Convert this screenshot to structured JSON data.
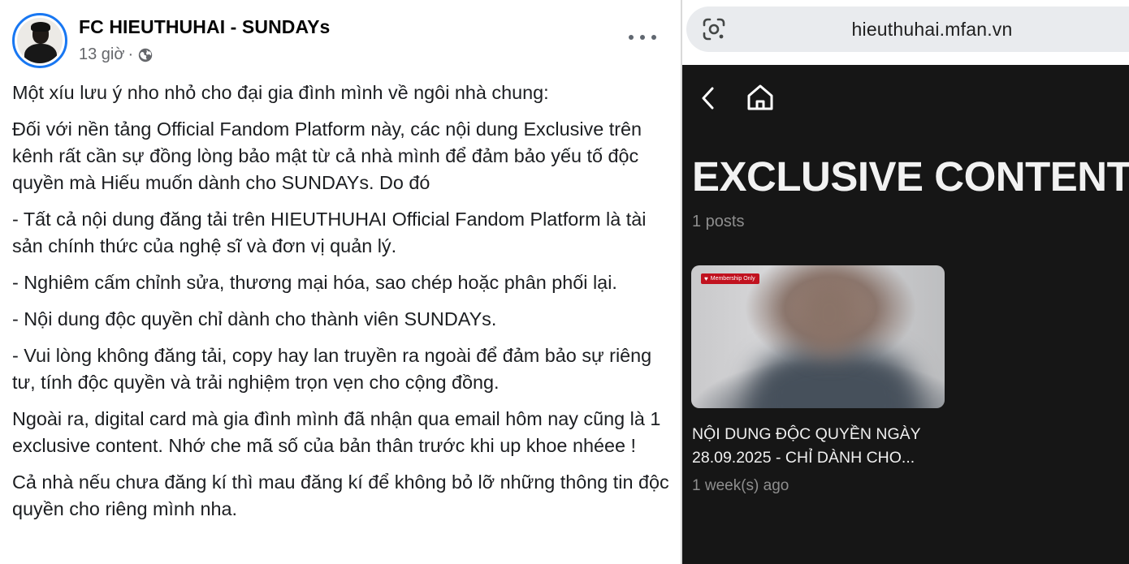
{
  "facebook_post": {
    "page_name": "FC HIEUTHUHAI - SUNDAYs",
    "time": "13 giờ",
    "separator": "·",
    "privacy_icon": "globe-icon",
    "more_icon": "more-options-icon",
    "paragraphs": [
      "Một xíu lưu ý nho nhỏ cho đại gia đình mình về ngôi nhà chung:",
      "Đối với nền tảng Official Fandom Platform này, các nội dung Exclusive trên kênh rất cần sự đồng lòng bảo mật từ cả nhà mình để đảm bảo yếu tố độc quyền mà Hiếu muốn dành cho SUNDAYs. Do đó",
      "- Tất cả nội dung đăng tải trên HIEUTHUHAI Official Fandom Platform là tài sản chính thức của nghệ sĩ và đơn vị quản lý.",
      "- Nghiêm cấm chỉnh sửa, thương mại hóa, sao chép hoặc phân phối lại.",
      "- Nội dung độc quyền chỉ dành cho thành viên SUNDAYs.",
      "- Vui lòng không đăng tải, copy hay lan truyền ra ngoài để đảm bảo sự riêng tư, tính độc quyền và trải nghiệm trọn vẹn cho cộng đồng.",
      "Ngoài ra, digital card mà gia đình mình đã nhận qua email hôm nay cũng là 1 exclusive content. Nhớ che mã số của bản thân trước khi up khoe nhéee !",
      "Cả nhà nếu chưa đăng kí thì mau đăng kí để không bỏ lỡ những thông tin độc quyền cho riêng mình nha."
    ]
  },
  "browser": {
    "url": "hieuthuhai.mfan.vn",
    "lens_icon": "google-lens-icon"
  },
  "exclusive_page": {
    "back_icon": "chevron-left-icon",
    "home_icon": "home-icon",
    "title": "EXCLUSIVE CONTENT",
    "post_count": "1 posts",
    "posts": [
      {
        "badge": "Membership Only",
        "title": "NỘI DUNG ĐỘC QUYỀN NGÀY 28.09.2025 - CHỈ DÀNH CHO...",
        "time": "1 week(s) ago"
      }
    ]
  },
  "colors": {
    "facebook_text": "#1c1e21",
    "facebook_meta": "#65676b",
    "avatar_ring": "#1877f2",
    "app_background": "#161616",
    "badge_red": "#c1121f"
  }
}
